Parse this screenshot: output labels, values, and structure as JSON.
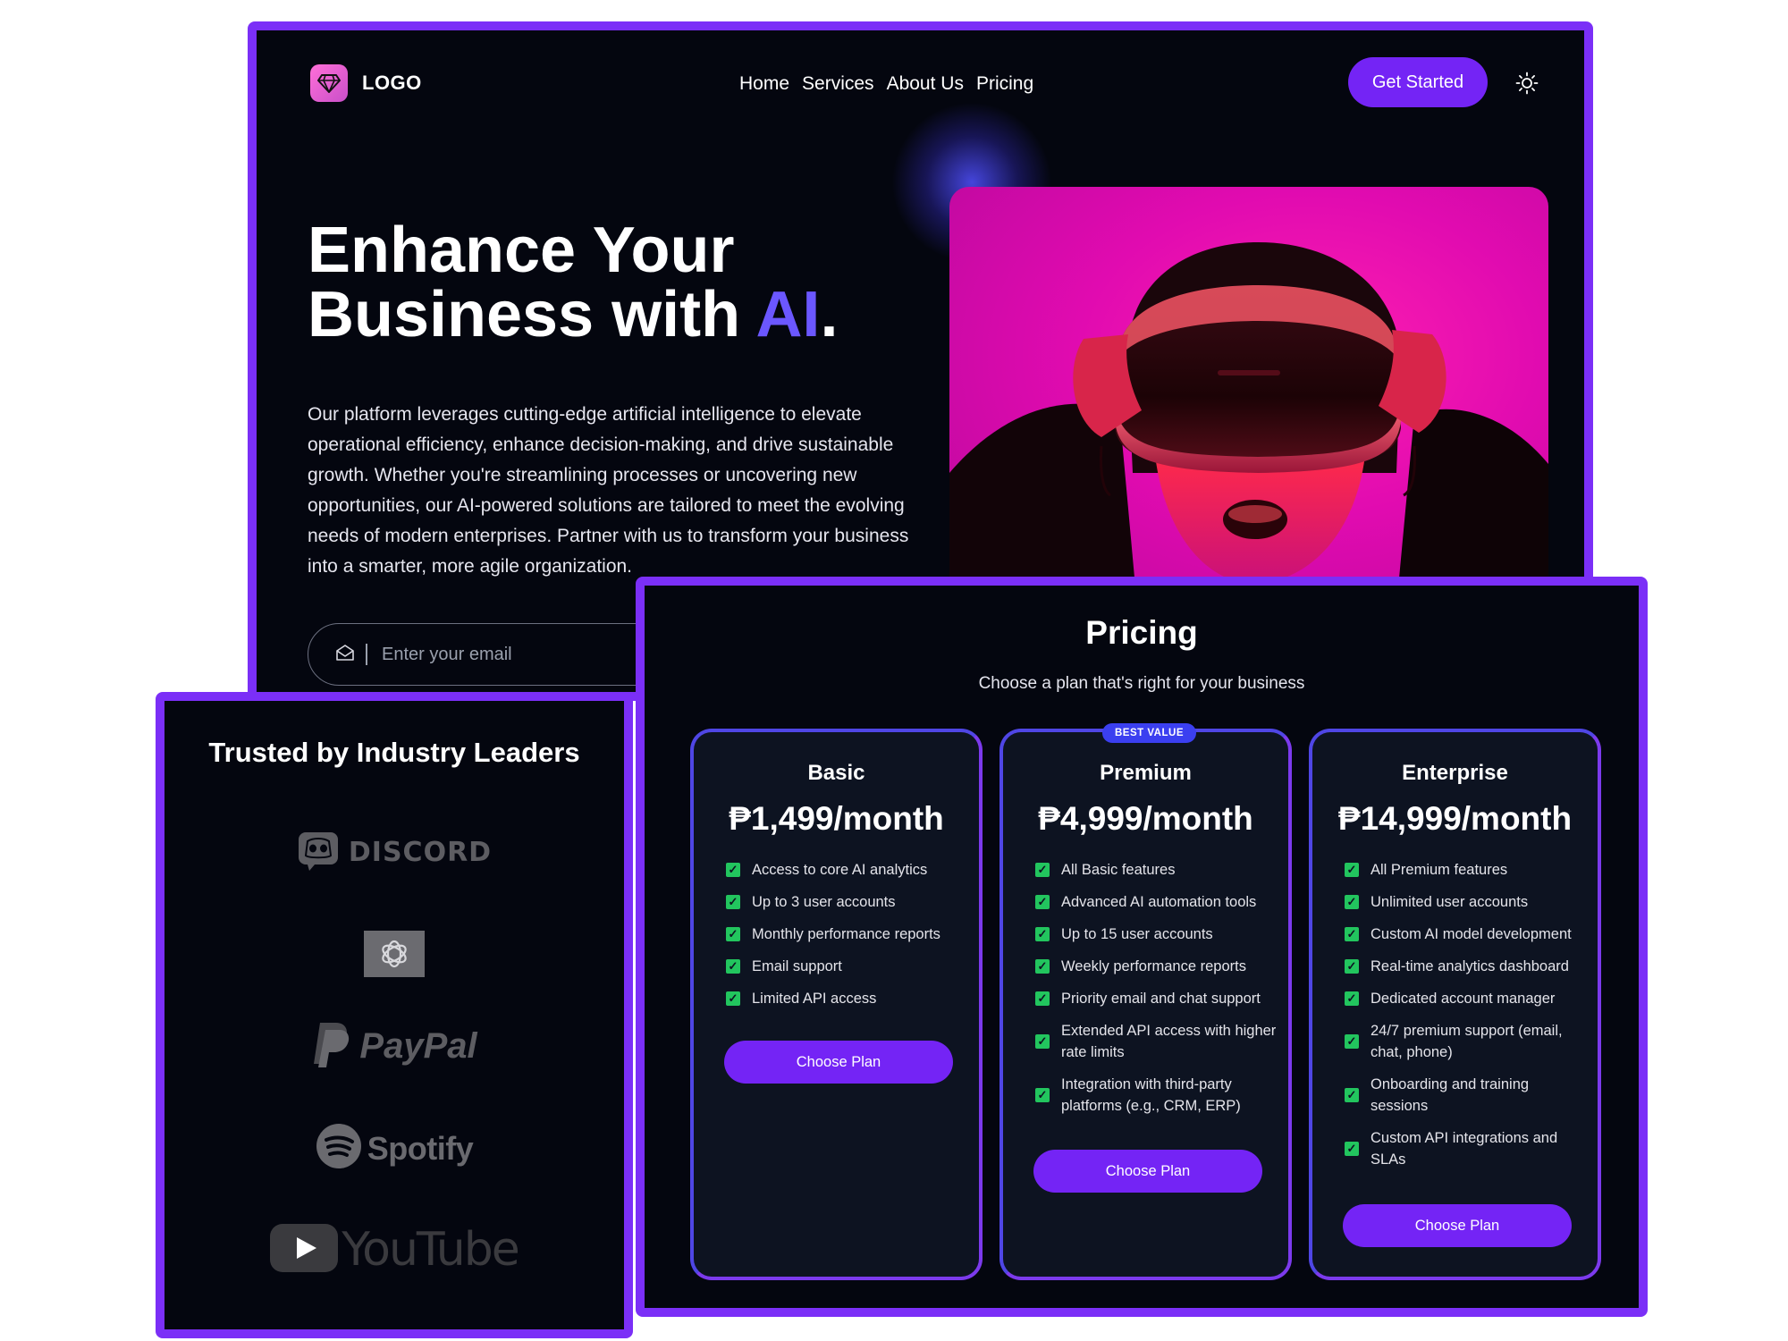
{
  "header": {
    "logo_text": "LOGO",
    "nav": [
      "Home",
      "Services",
      "About Us",
      "Pricing"
    ],
    "cta_label": "Get Started"
  },
  "hero": {
    "title_line1": "Enhance Your",
    "title_line2_prefix": "Business with ",
    "title_accent": "AI",
    "title_suffix": ".",
    "description": "Our platform leverages cutting-edge artificial intelligence to elevate operational efficiency, enhance decision-making, and drive sustainable growth. Whether you're streamlining processes or uncovering new opportunities, our AI-powered solutions are tailored to meet the evolving needs of modern enterprises. Partner with us to transform your business into a smarter, more agile organization.",
    "email_placeholder": "Enter your email"
  },
  "trusted": {
    "title": "Trusted by Industry Leaders",
    "brands": [
      "DISCORD",
      "PayPal",
      "Spotify",
      "YouTube"
    ]
  },
  "pricing": {
    "title": "Pricing",
    "subtitle": "Choose a plan that's right for your business",
    "plans": [
      {
        "name": "Basic",
        "price": "₱1,499/month",
        "features": [
          "Access to core AI analytics",
          "Up to 3 user accounts",
          "Monthly performance reports",
          "Email support",
          "Limited API access"
        ],
        "button": "Choose Plan"
      },
      {
        "name": "Premium",
        "badge": "BEST VALUE",
        "price": "₱4,999/month",
        "features": [
          "All Basic features",
          "Advanced AI automation tools",
          "Up to 15 user accounts",
          "Weekly performance reports",
          "Priority email and chat support",
          "Extended API access with higher rate limits",
          "Integration with third-party platforms (e.g., CRM, ERP)"
        ],
        "button": "Choose Plan"
      },
      {
        "name": "Enterprise",
        "price": "₱14,999/month",
        "features": [
          "All Premium features",
          "Unlimited user accounts",
          "Custom AI model development",
          "Real-time analytics dashboard",
          "Dedicated account manager",
          "24/7 premium support (email, chat, phone)",
          "Onboarding and training sessions",
          "Custom API integrations and SLAs"
        ],
        "button": "Choose Plan"
      }
    ]
  },
  "colors": {
    "accent": "#7424f5",
    "frame_border": "#7b2ff7",
    "background": "#04060f",
    "check": "#22c55e",
    "ai_accent": "#6b57ff"
  }
}
